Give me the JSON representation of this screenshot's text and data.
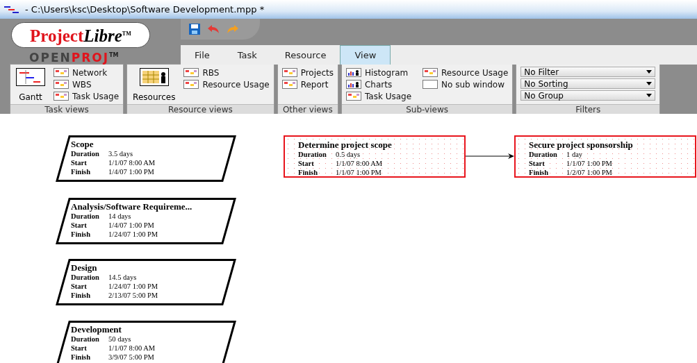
{
  "window": {
    "title": "- C:\\Users\\ksc\\Desktop\\Software Development.mpp *"
  },
  "logo": {
    "main_red": "Project",
    "main_black": "Libre",
    "main_mark": "TM",
    "sub": "OPEN**PROJ**$^{TM}$"
  },
  "tabs": [
    {
      "label": "File",
      "selected": false
    },
    {
      "label": "Task",
      "selected": false
    },
    {
      "label": "Resource",
      "selected": false
    },
    {
      "label": "View",
      "selected": true
    }
  ],
  "ribbon_groups": [
    {
      "title": "Task views",
      "large": {
        "label": "Gantt",
        "kind": "gantt"
      },
      "items": [
        {
          "label": "Network",
          "kind": "view"
        },
        {
          "label": "WBS",
          "kind": "view"
        },
        {
          "label": "Task Usage",
          "kind": "view"
        }
      ]
    },
    {
      "title": "Resource views",
      "large": {
        "label": "Resources",
        "kind": "resources"
      },
      "items": [
        {
          "label": "RBS",
          "kind": "view"
        },
        {
          "label": "Resource Usage",
          "kind": "view"
        }
      ]
    },
    {
      "title": "Other views",
      "items": [
        {
          "label": "Projects",
          "kind": "view"
        },
        {
          "label": "Report",
          "kind": "view"
        }
      ]
    },
    {
      "title": "Sub-views",
      "items": [
        {
          "label": "Histogram",
          "kind": "chart"
        },
        {
          "label": "Charts",
          "kind": "chart"
        },
        {
          "label": "Task Usage",
          "kind": "view"
        },
        {
          "label": "Resource Usage",
          "kind": "view"
        },
        {
          "label": "No sub window",
          "kind": "blank"
        }
      ]
    },
    {
      "title": "Filters",
      "dropdowns": [
        "No Filter",
        "No Sorting",
        "No Group"
      ]
    }
  ],
  "network_nodes": [
    {
      "kind": "summary",
      "name": "Scope",
      "fields": [
        {
          "label": "Duration",
          "value": "3.5 days"
        },
        {
          "label": "Start",
          "value": "1/1/07 8:00 AM"
        },
        {
          "label": "Finish",
          "value": "1/4/07 1:00 PM"
        }
      ]
    },
    {
      "kind": "critical_task",
      "name": "Determine project scope",
      "links_to_next": true,
      "fields": [
        {
          "label": "Duration",
          "value": "0.5 days"
        },
        {
          "label": "Start",
          "value": "1/1/07 8:00 AM"
        },
        {
          "label": "Finish",
          "value": "1/1/07 1:00 PM"
        }
      ]
    },
    {
      "kind": "critical_task",
      "name": "Secure project sponsorship",
      "fields": [
        {
          "label": "Duration",
          "value": "1 day"
        },
        {
          "label": "Start",
          "value": "1/1/07 1:00 PM"
        },
        {
          "label": "Finish",
          "value": "1/2/07 1:00 PM"
        }
      ]
    },
    {
      "kind": "summary",
      "name": "Analysis/Software Requireme...",
      "fields": [
        {
          "label": "Duration",
          "value": "14 days"
        },
        {
          "label": "Start",
          "value": "1/4/07 1:00 PM"
        },
        {
          "label": "Finish",
          "value": "1/24/07 1:00 PM"
        }
      ]
    },
    {
      "kind": "summary",
      "name": "Design",
      "fields": [
        {
          "label": "Duration",
          "value": "14.5 days"
        },
        {
          "label": "Start",
          "value": "1/24/07 1:00 PM"
        },
        {
          "label": "Finish",
          "value": "2/13/07 5:00 PM"
        }
      ]
    },
    {
      "kind": "summary",
      "name": "Development",
      "fields": [
        {
          "label": "Duration",
          "value": "50 days"
        },
        {
          "label": "Start",
          "value": "1/1/07 8:00 AM"
        },
        {
          "label": "Finish",
          "value": "3/9/07 5:00 PM"
        }
      ]
    }
  ]
}
